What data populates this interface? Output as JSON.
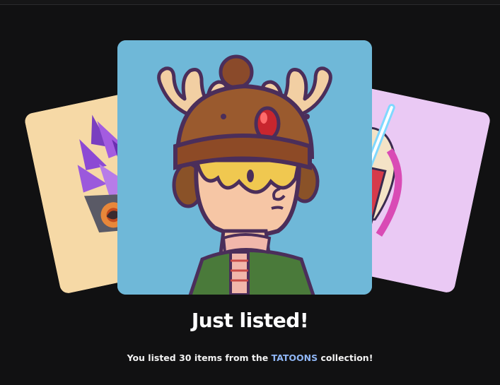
{
  "modal": {
    "heading": "Just listed!",
    "message_prefix": "You listed 30 items from the ",
    "collection_name": "TATOONS",
    "message_suffix": " collection!"
  },
  "cards": [
    {
      "name": "left-nft-card",
      "art": "purple-crystal-creature"
    },
    {
      "name": "center-nft-card",
      "art": "reindeer-hat-character"
    },
    {
      "name": "right-nft-card",
      "art": "lightsaber-character"
    }
  ],
  "colors": {
    "background": "#111112",
    "link": "#8fb6f5",
    "center_card_bg": "#6fb8d8",
    "left_card_bg": "#f6d9a6",
    "right_card_bg": "#eac9f4"
  }
}
